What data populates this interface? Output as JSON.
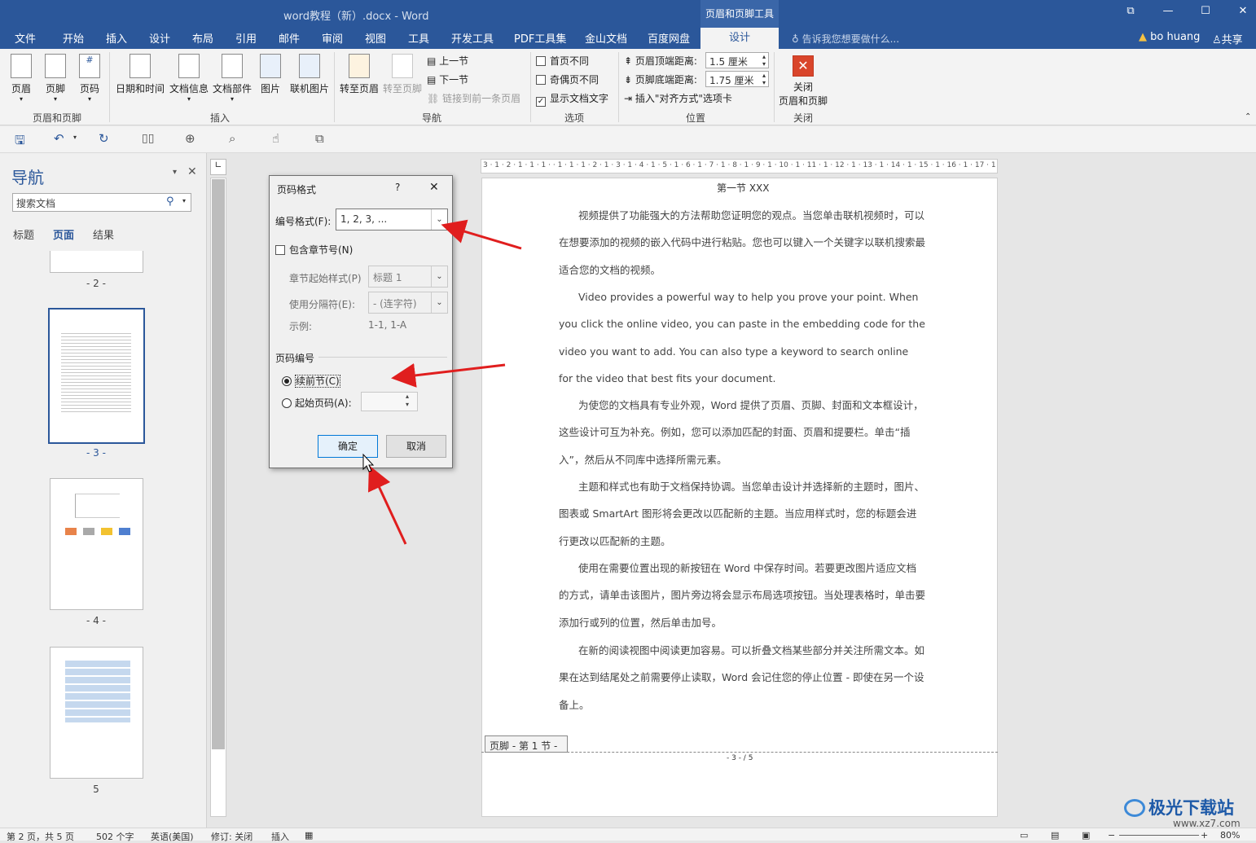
{
  "window": {
    "title": "word教程（新）.docx - Word",
    "context_tab_title": "页眉和页脚工具"
  },
  "tabs": [
    "文件",
    "开始",
    "插入",
    "设计",
    "布局",
    "引用",
    "邮件",
    "审阅",
    "视图",
    "工具",
    "开发工具",
    "PDF工具集",
    "金山文档",
    "百度网盘"
  ],
  "active_tab": "设计",
  "tell_me": "告诉我您想要做什么...",
  "user": "bo huang",
  "share": "共享",
  "ribbon": {
    "hf": {
      "header": "页眉",
      "footer": "页脚",
      "page_num": "页码",
      "group": "页眉和页脚"
    },
    "insert": {
      "datetime": "日期和时间",
      "docinfo": "文档信息",
      "parts": "文档部件",
      "picture": "图片",
      "online_picture": "联机图片",
      "group": "插入"
    },
    "nav": {
      "goto_header": "转至页眉",
      "goto_footer": "转至页脚",
      "prev": "上一节",
      "next": "下一节",
      "link_prev": "链接到前一条页眉",
      "group": "导航"
    },
    "options": {
      "first_diff": "首页不同",
      "odd_even": "奇偶页不同",
      "show_text": "显示文档文字",
      "group": "选项"
    },
    "position": {
      "header_dist_label": "页眉顶端距离:",
      "header_dist": "1.5 厘米",
      "footer_dist_label": "页脚底端距离:",
      "footer_dist": "1.75 厘米",
      "insert_align": "插入\"对齐方式\"选项卡",
      "group": "位置"
    },
    "close": {
      "label_line1": "关闭",
      "label_line2": "页眉和页脚",
      "group": "关闭"
    }
  },
  "nav_pane": {
    "title": "导航",
    "search_placeholder": "搜索文档",
    "tabs": [
      "标题",
      "页面",
      "结果"
    ],
    "pages": [
      "- 2 -",
      "- 3 -",
      "- 4 -",
      "5"
    ]
  },
  "ruler": {
    "horizontal": "3 · 1 · 2 · 1 · 1 · 1 ·  · 1 · 1 · 1 · 2 · 1 · 3 · 1 · 4 · 1 · 5 · 1 · 6 · 1 · 7 · 1 · 8 · 1 · 9 · 1 · 10 · 1 · 11 · 1 · 12 · 1 · 13 · 1 · 14 · 1 · 15 · 1 · 16 · 1 · 17 · 1 ·"
  },
  "document": {
    "heading": "第一节  XXX",
    "paragraphs": [
      "视频提供了功能强大的方法帮助您证明您的观点。当您单击联机视频时，可以在想要添加的视频的嵌入代码中进行粘贴。您也可以键入一个关键字以联机搜索最适合您的文档的视频。",
      "Video provides a powerful way to help you prove your point. When you click the online video, you can paste in the embedding code for the video you want to add. You can also type a keyword to search online for the video that best fits your document.",
      "为使您的文档具有专业外观，Word 提供了页眉、页脚、封面和文本框设计，这些设计可互为补充。例如，您可以添加匹配的封面、页眉和提要栏。单击“插入”，然后从不同库中选择所需元素。",
      "主题和样式也有助于文档保持协调。当您单击设计并选择新的主题时，图片、图表或 SmartArt 图形将会更改以匹配新的主题。当应用样式时，您的标题会进行更改以匹配新的主题。",
      "使用在需要位置出现的新按钮在 Word 中保存时间。若要更改图片适应文档的方式，请单击该图片，图片旁边将会显示布局选项按钮。当处理表格时，单击要添加行或列的位置，然后单击加号。",
      "在新的阅读视图中阅读更加容易。可以折叠文档某些部分并关注所需文本。如果在达到结尾处之前需要停止读取，Word 会记住您的停止位置 - 即使在另一个设备上。"
    ],
    "footer_tag": "页脚 - 第 1 节 -",
    "page_number": "- 3 - / 5"
  },
  "dialog": {
    "title": "页码格式",
    "help": "?",
    "close": "✕",
    "number_format_label": "编号格式(F):",
    "number_format_value": "1, 2, 3, ...",
    "include_chapter_label": "包含章节号(N)",
    "chapter_style_label": "章节起始样式(P)",
    "chapter_style_value": "标题 1",
    "separator_label": "使用分隔符(E):",
    "separator_value": "-  (连字符)",
    "example_label": "示例:",
    "example_value": "1-1, 1-A",
    "page_numbering_label": "页码编号",
    "continue_label": "续前节(C)",
    "start_at_label": "起始页码(A):",
    "start_at_value": "",
    "ok": "确定",
    "cancel": "取消"
  },
  "status": {
    "page": "第 2 页，共 5 页",
    "words": "502 个字",
    "language": "英语(美国)",
    "track": "修订: 关闭",
    "mode": "插入",
    "zoom": "80%"
  },
  "watermark": {
    "brand": "极光下载站",
    "url": "www.xz7.com"
  }
}
